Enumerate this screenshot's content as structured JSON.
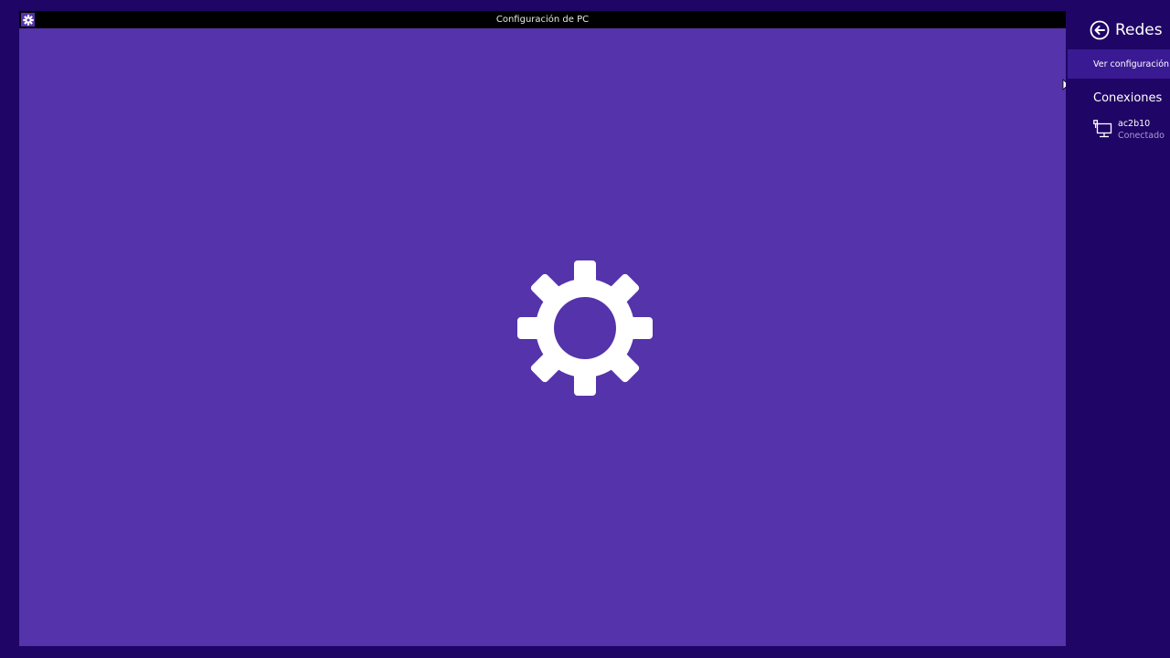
{
  "window": {
    "title": "Configuración de PC",
    "app_icon": "gear-icon",
    "splash_icon": "gear-icon"
  },
  "network_panel": {
    "back_icon": "back-arrow-circle-icon",
    "title": "Redes",
    "view_settings_label": "Ver configuración d",
    "connections_heading": "Conexiones",
    "connections": [
      {
        "name": "ac2b10",
        "status": "Conectado",
        "icon": "ethernet-icon"
      }
    ]
  },
  "colors": {
    "desktop_background": "#1f0565",
    "app_background": "#5433ab",
    "titlebar": "#000000",
    "panel_background": "#1f0565",
    "panel_selected": "#3a1a93",
    "secondary_text": "#a99ad6",
    "foreground": "#ffffff"
  }
}
